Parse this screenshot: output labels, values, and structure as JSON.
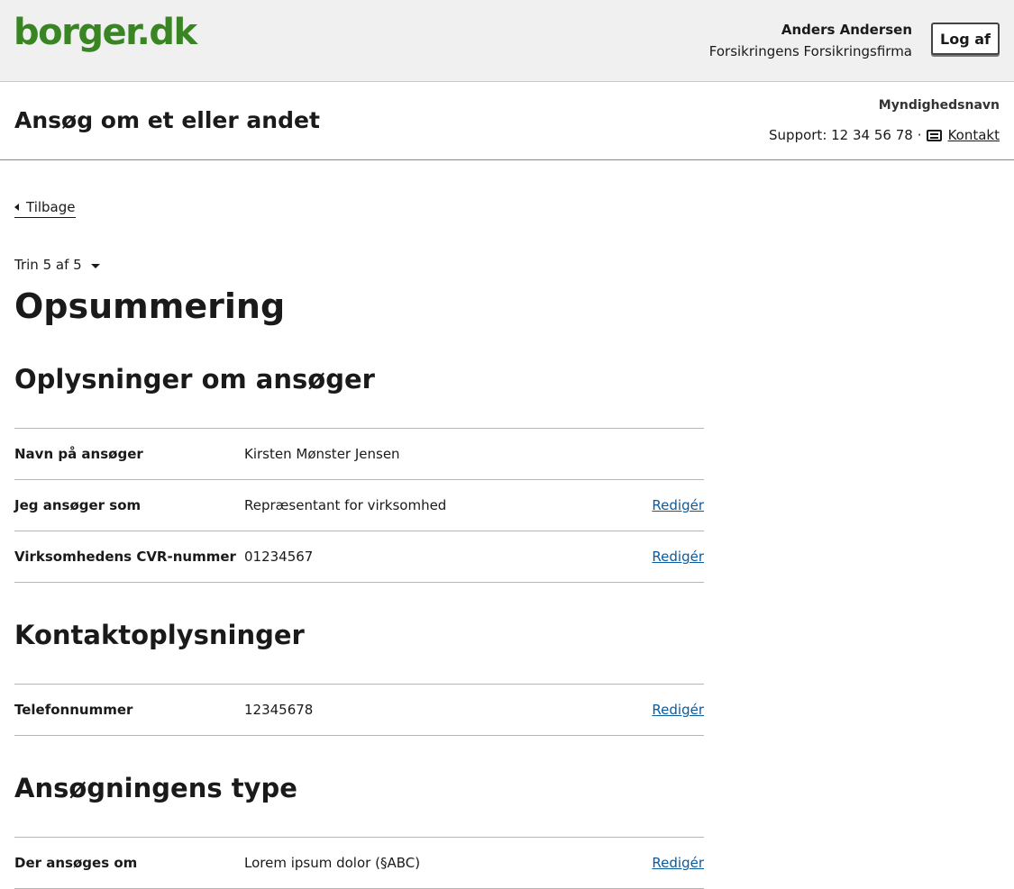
{
  "header": {
    "logo": "borger.dk",
    "user_name": "Anders Andersen",
    "user_org": "Forsikringens Forsikringsfirma",
    "logout_label": "Log af"
  },
  "service": {
    "title": "Ansøg om et eller andet",
    "authority": "Myndighedsnavn",
    "support_text": "Support: 12 34 56 78",
    "separator": "·",
    "contact_label": "Kontakt"
  },
  "nav": {
    "back_label": "Tilbage",
    "step_label": "Trin 5 af 5"
  },
  "page": {
    "title": "Opsummering"
  },
  "sections": [
    {
      "title": "Oplysninger om ansøger",
      "rows": [
        {
          "label": "Navn på ansøger",
          "value": "Kirsten Mønster Jensen",
          "edit": ""
        },
        {
          "label": "Jeg ansøger som",
          "value": "Repræsentant for virksomhed",
          "edit": "Redigér"
        },
        {
          "label": "Virksomhedens CVR-nummer",
          "value": "01234567",
          "edit": "Redigér"
        }
      ]
    },
    {
      "title": "Kontaktoplysninger",
      "rows": [
        {
          "label": "Telefonnummer",
          "value": "12345678",
          "edit": "Redigér"
        }
      ]
    },
    {
      "title": "Ansøgningens type",
      "rows": [
        {
          "label": "Der ansøges om",
          "value": "Lorem ipsum dolor (§ABC)",
          "edit": "Redigér"
        }
      ]
    }
  ],
  "colors": {
    "brand_green": "#3a8523",
    "link_blue": "#0a5aa0"
  }
}
